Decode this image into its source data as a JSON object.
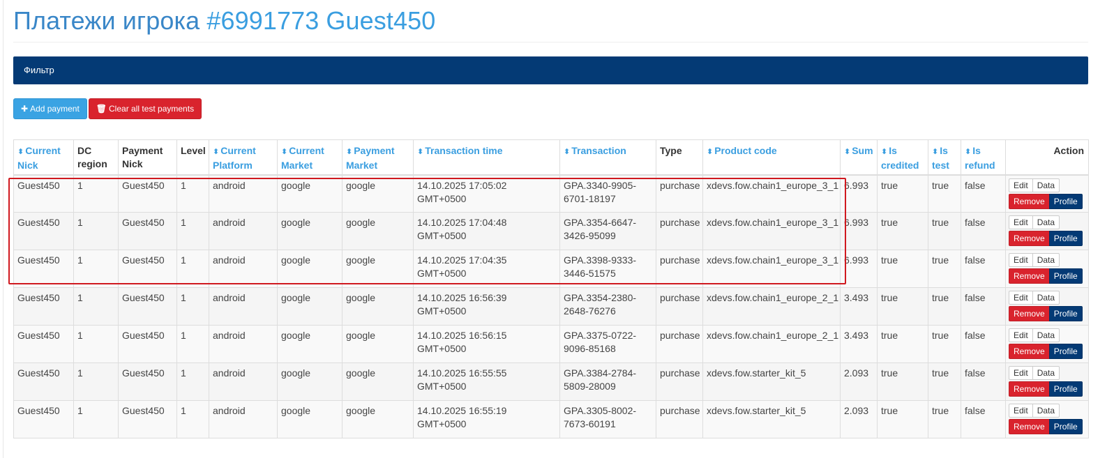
{
  "header": {
    "title_text": "Платежи игрока ",
    "title_id": "#6991773 Guest450"
  },
  "filter": {
    "label": "Фильтр"
  },
  "toolbar": {
    "add_label": "Add payment",
    "add_icon": "plus-icon",
    "clear_label": "Clear all test payments",
    "clear_icon": "trash-icon"
  },
  "table": {
    "columns": [
      {
        "label": "Current Nick",
        "sortable": true
      },
      {
        "label": "DC region",
        "sortable": false
      },
      {
        "label": "Payment Nick",
        "sortable": false
      },
      {
        "label": "Level",
        "sortable": false
      },
      {
        "label": "Current Platform",
        "sortable": true
      },
      {
        "label": "Current Market",
        "sortable": true
      },
      {
        "label": "Payment Market",
        "sortable": true
      },
      {
        "label": "Transaction time",
        "sortable": true
      },
      {
        "label": "Transaction",
        "sortable": true
      },
      {
        "label": "Type",
        "sortable": false
      },
      {
        "label": "Product code",
        "sortable": true
      },
      {
        "label": "Sum",
        "sortable": true
      },
      {
        "label": "Is credited",
        "sortable": true
      },
      {
        "label": "Is test",
        "sortable": true
      },
      {
        "label": "Is refund",
        "sortable": true
      },
      {
        "label": "Action",
        "sortable": false
      }
    ],
    "action_labels": {
      "edit": "Edit",
      "data": "Data",
      "remove": "Remove",
      "profile": "Profile"
    },
    "rows": [
      [
        "Guest450",
        "1",
        "Guest450",
        "1",
        "android",
        "google",
        "google",
        "14.10.2025 17:05:02 GMT+0500",
        "GPA.3340-9905-6701-18197",
        "purchase",
        "xdevs.fow.chain1_europe_3_1",
        "6.993",
        "true",
        "true",
        "false"
      ],
      [
        "Guest450",
        "1",
        "Guest450",
        "1",
        "android",
        "google",
        "google",
        "14.10.2025 17:04:48 GMT+0500",
        "GPA.3354-6647-3426-95099",
        "purchase",
        "xdevs.fow.chain1_europe_3_1",
        "6.993",
        "true",
        "true",
        "false"
      ],
      [
        "Guest450",
        "1",
        "Guest450",
        "1",
        "android",
        "google",
        "google",
        "14.10.2025 17:04:35 GMT+0500",
        "GPA.3398-9333-3446-51575",
        "purchase",
        "xdevs.fow.chain1_europe_3_1",
        "6.993",
        "true",
        "true",
        "false"
      ],
      [
        "Guest450",
        "1",
        "Guest450",
        "1",
        "android",
        "google",
        "google",
        "14.10.2025 16:56:39 GMT+0500",
        "GPA.3354-2380-2648-76276",
        "purchase",
        "xdevs.fow.chain1_europe_2_1",
        "3.493",
        "true",
        "true",
        "false"
      ],
      [
        "Guest450",
        "1",
        "Guest450",
        "1",
        "android",
        "google",
        "google",
        "14.10.2025 16:56:15 GMT+0500",
        "GPA.3375-0722-9096-85168",
        "purchase",
        "xdevs.fow.chain1_europe_2_1",
        "3.493",
        "true",
        "true",
        "false"
      ],
      [
        "Guest450",
        "1",
        "Guest450",
        "1",
        "android",
        "google",
        "google",
        "14.10.2025 16:55:55 GMT+0500",
        "GPA.3384-2784-5809-28009",
        "purchase",
        "xdevs.fow.starter_kit_5",
        "2.093",
        "true",
        "true",
        "false"
      ],
      [
        "Guest450",
        "1",
        "Guest450",
        "1",
        "android",
        "google",
        "google",
        "14.10.2025 16:55:19 GMT+0500",
        "GPA.3305-8002-7673-60191",
        "purchase",
        "xdevs.fow.starter_kit_5",
        "2.093",
        "true",
        "true",
        "false"
      ]
    ]
  },
  "annotation": {
    "color": "#d0191f",
    "rows_highlighted": [
      0,
      1,
      2
    ]
  },
  "colors": {
    "title_blue": "#3a87c8",
    "filter_bar": "#043a75",
    "sort_link": "#3a9ee0",
    "danger": "#d9232d",
    "primary_dark": "#043a75"
  }
}
